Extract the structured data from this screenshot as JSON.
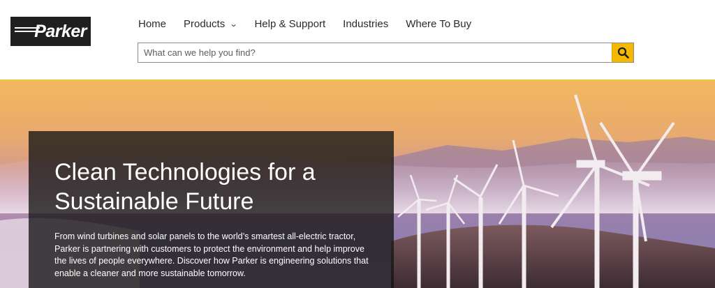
{
  "brand": {
    "logo_text": "Parker"
  },
  "nav": {
    "items": [
      {
        "label": "Home"
      },
      {
        "label": "Products"
      },
      {
        "label": "Help & Support"
      },
      {
        "label": "Industries"
      },
      {
        "label": "Where To Buy"
      }
    ]
  },
  "search": {
    "placeholder": "What can we help you find?",
    "value": ""
  },
  "hero": {
    "title_line1": "Clean Technologies for a",
    "title_line2": "Sustainable Future",
    "body": "From wind turbines and solar panels to the world’s smartest all-electric tractor, Parker is partnering with customers to protect the environment and help improve the lives of people everywhere. Discover how Parker is engineering solutions that enable a cleaner and more sustainable tomorrow."
  },
  "colors": {
    "accent": "#f5b800",
    "header_border": "#f3c243",
    "logo_bg": "#1f1f1f"
  }
}
